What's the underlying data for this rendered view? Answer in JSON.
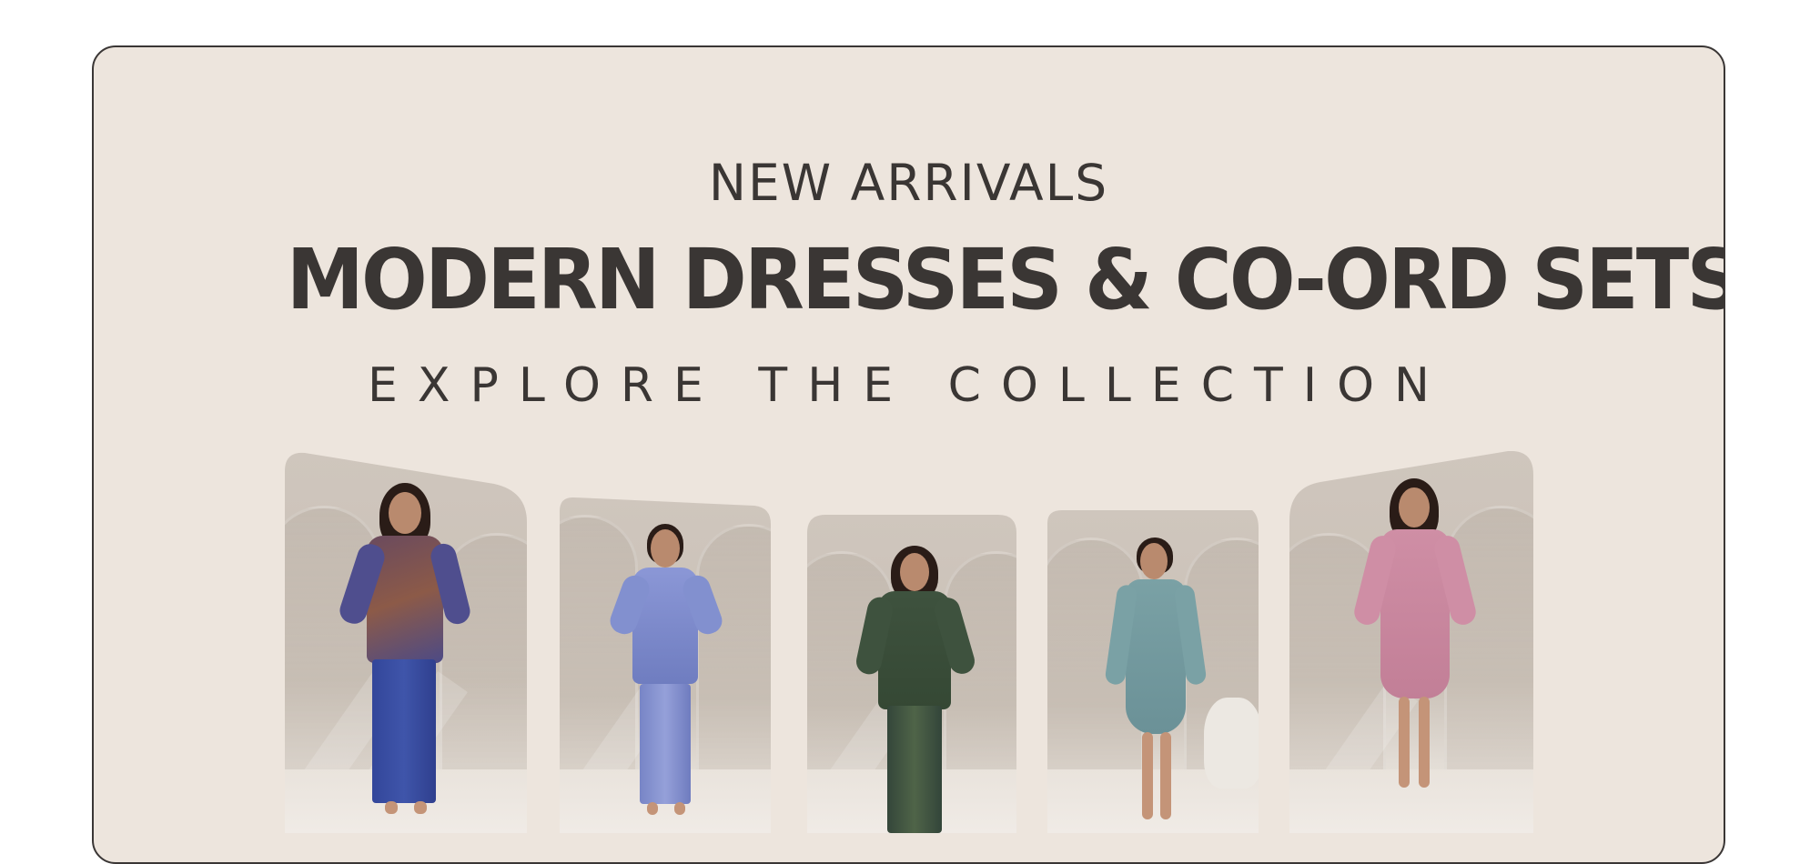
{
  "banner": {
    "kicker": "NEW ARRIVALS",
    "headline": "MODERN DRESSES & CO-ORD SETS",
    "subline": "EXPLORE THE COLLECTION"
  },
  "products": [
    {
      "name": "paisley print co-ord set",
      "color": "#3d4f9a"
    },
    {
      "name": "blue floral shirt co-ord set",
      "color": "#7f8cc8"
    },
    {
      "name": "green floral co-ord set",
      "color": "#3c4f3b"
    },
    {
      "name": "teal embroidered dress",
      "color": "#6e969b"
    },
    {
      "name": "pink embroidered dress",
      "color": "#c7869c"
    }
  ],
  "colors": {
    "background": "#ede5dd",
    "text": "#3a3634",
    "border": "#3a3635"
  }
}
